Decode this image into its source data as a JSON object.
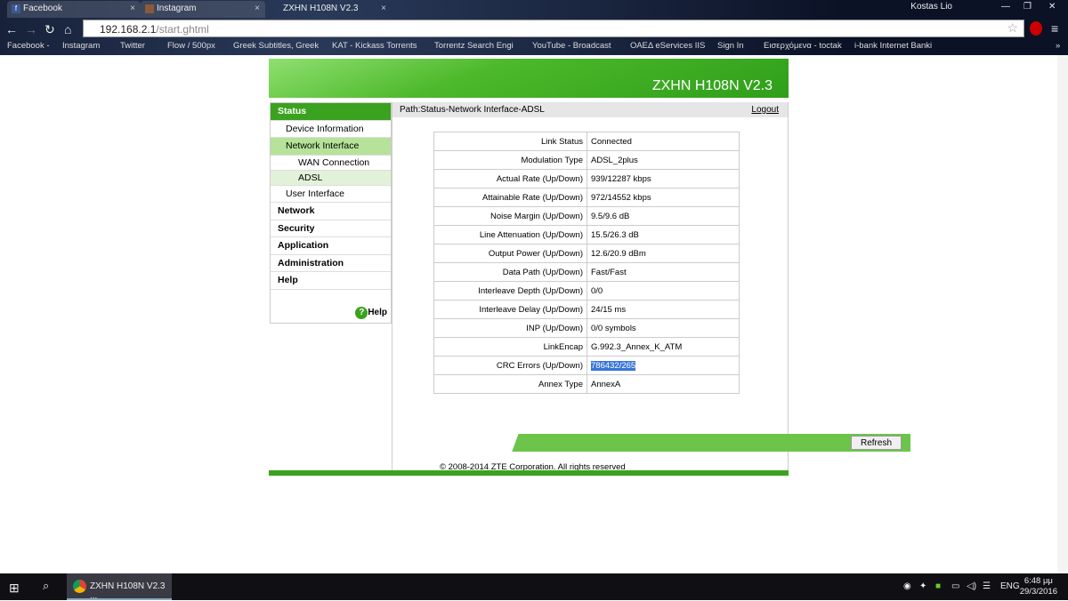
{
  "browser": {
    "tabs": [
      {
        "label": "Facebook",
        "icon": "facebook-icon"
      },
      {
        "label": "Instagram",
        "icon": "instagram-icon"
      },
      {
        "label": "ZXHN H108N V2.3",
        "active": true
      }
    ],
    "user": "Kostas Lio",
    "address_host": "192.168.2.1",
    "address_path": "/start.ghtml",
    "bookmarks": [
      "Facebook -",
      "Instagram",
      "Twitter",
      "Flow / 500px",
      "Greek Subtitles, Greek",
      "KAT - Kickass Torrents",
      "Torrentz Search Engi",
      "YouTube - Broadcast",
      "ΟΑΕΔ eServices IIS",
      "Sign In",
      "Εισερχόμενα - toctak",
      "i-bank Internet Banki"
    ],
    "more": "»"
  },
  "router": {
    "title": "ZXHN H108N V2.3",
    "menu": [
      {
        "label": "Status",
        "level": 0,
        "active": true
      },
      {
        "label": "Device Information",
        "level": 1
      },
      {
        "label": "Network Interface",
        "level": 1,
        "selected": true
      },
      {
        "label": "WAN Connection",
        "level": 2
      },
      {
        "label": "ADSL",
        "level": 2,
        "selected": true
      },
      {
        "label": "User Interface",
        "level": 1
      },
      {
        "label": "Network",
        "level": 0
      },
      {
        "label": "Security",
        "level": 0
      },
      {
        "label": "Application",
        "level": 0
      },
      {
        "label": "Administration",
        "level": 0
      },
      {
        "label": "Help",
        "level": 0
      }
    ],
    "help": "Help",
    "help_icon": "?",
    "path": "Path:Status-Network Interface-ADSL",
    "logout": "Logout",
    "rows": [
      [
        "Link Status",
        "Connected"
      ],
      [
        "Modulation Type",
        "ADSL_2plus"
      ],
      [
        "Actual Rate (Up/Down)",
        "939/12287 kbps"
      ],
      [
        "Attainable Rate (Up/Down)",
        "972/14552 kbps"
      ],
      [
        "Noise Margin (Up/Down)",
        "9.5/9.6 dB"
      ],
      [
        "Line Attenuation (Up/Down)",
        "15.5/26.3 dB"
      ],
      [
        "Output Power (Up/Down)",
        "12.6/20.9 dBm"
      ],
      [
        "Data Path (Up/Down)",
        "Fast/Fast"
      ],
      [
        "Interleave Depth (Up/Down)",
        "0/0"
      ],
      [
        "Interleave Delay (Up/Down)",
        "24/15 ms"
      ],
      [
        "INP (Up/Down)",
        "0/0 symbols"
      ],
      [
        "LinkEncap",
        "G.992.3_Annex_K_ATM"
      ],
      [
        "CRC Errors (Up/Down)",
        "786432/265"
      ],
      [
        "Annex Type",
        "AnnexA"
      ]
    ],
    "refresh": "Refresh",
    "copyright": "© 2008-2014 ZTE Corporation. All rights reserved"
  },
  "taskbar": {
    "app": "ZXHN H108N V2.3 ...",
    "lang": "ENG",
    "time": "6:48 μμ",
    "date": "29/3/2016"
  }
}
